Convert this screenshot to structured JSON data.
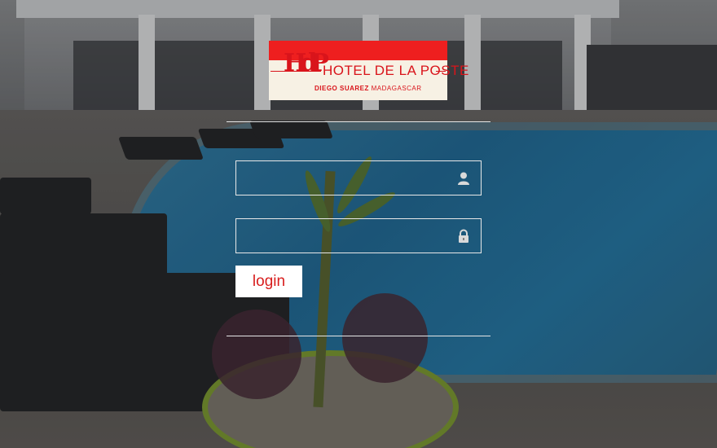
{
  "logo": {
    "monogram": "HdP",
    "name": "HOTEL DE LA POSTE",
    "subtitle_bold": "DIEGO SUAREZ",
    "subtitle_rest": "MADAGASCAR"
  },
  "form": {
    "username": {
      "value": "",
      "placeholder": "",
      "icon": "user-icon"
    },
    "password": {
      "value": "",
      "placeholder": "",
      "icon": "lock-icon"
    },
    "login_label": "login"
  },
  "colors": {
    "brand_red": "#ee1f1f",
    "text_red": "#d81d1d",
    "logo_cream": "#f7f1e4",
    "field_border": "#e8e8e8"
  }
}
